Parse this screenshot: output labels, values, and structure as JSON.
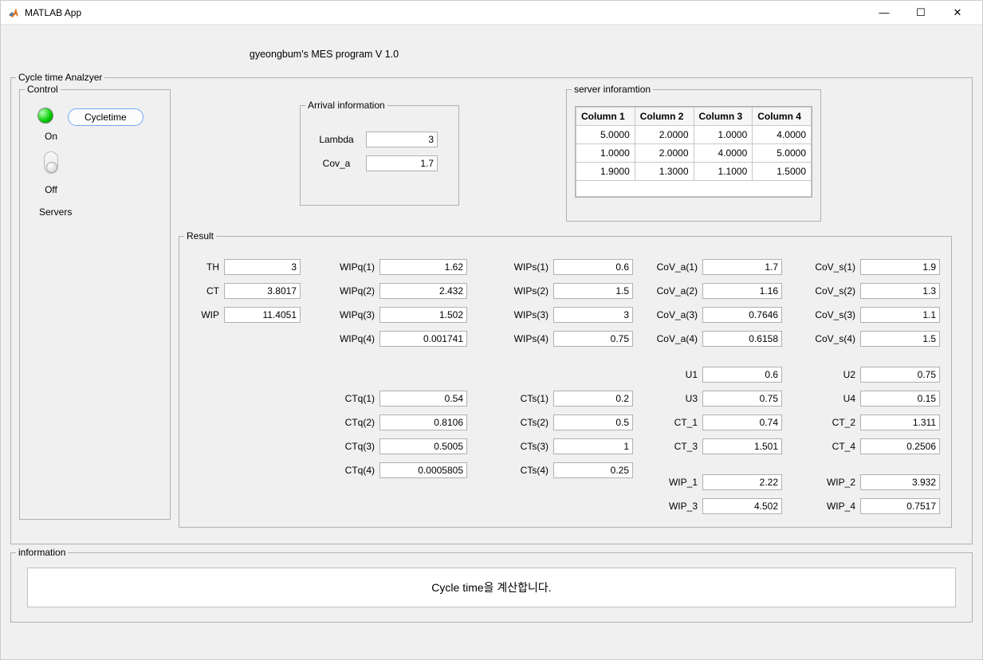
{
  "window": {
    "title": "MATLAB App"
  },
  "program_title": "gyeongbum's MES program V 1.0",
  "legends": {
    "analyzer": "Cycle time Analzyer",
    "control": "Control",
    "arrival": "Arrival information",
    "server": "server inforamtion",
    "result": "Result",
    "info": "information"
  },
  "control": {
    "on_label": "On",
    "off_label": "Off",
    "servers_label": "Servers",
    "cycle_btn": "Cycletime"
  },
  "arrival": {
    "lambda_label": "Lambda",
    "lambda_value": "3",
    "cova_label": "Cov_a",
    "cova_value": "1.7"
  },
  "server_table": {
    "headers": [
      "Column 1",
      "Column 2",
      "Column 3",
      "Column 4"
    ],
    "rows": [
      [
        "5.0000",
        "2.0000",
        "1.0000",
        "4.0000"
      ],
      [
        "1.0000",
        "2.0000",
        "4.0000",
        "5.0000"
      ],
      [
        "1.9000",
        "1.3000",
        "1.1000",
        "1.5000"
      ]
    ]
  },
  "result": {
    "TH": {
      "label": "TH",
      "value": "3"
    },
    "CT": {
      "label": "CT",
      "value": "3.8017"
    },
    "WIP": {
      "label": "WIP",
      "value": "11.4051"
    },
    "WIPq1": {
      "label": "WIPq(1)",
      "value": "1.62"
    },
    "WIPq2": {
      "label": "WIPq(2)",
      "value": "2.432"
    },
    "WIPq3": {
      "label": "WIPq(3)",
      "value": "1.502"
    },
    "WIPq4": {
      "label": "WIPq(4)",
      "value": "0.001741"
    },
    "WIPs1": {
      "label": "WIPs(1)",
      "value": "0.6"
    },
    "WIPs2": {
      "label": "WIPs(2)",
      "value": "1.5"
    },
    "WIPs3": {
      "label": "WIPs(3)",
      "value": "3"
    },
    "WIPs4": {
      "label": "WIPs(4)",
      "value": "0.75"
    },
    "CoVa1": {
      "label": "CoV_a(1)",
      "value": "1.7"
    },
    "CoVa2": {
      "label": "CoV_a(2)",
      "value": "1.16"
    },
    "CoVa3": {
      "label": "CoV_a(3)",
      "value": "0.7646"
    },
    "CoVa4": {
      "label": "CoV_a(4)",
      "value": "0.6158"
    },
    "CoVs1": {
      "label": "CoV_s(1)",
      "value": "1.9"
    },
    "CoVs2": {
      "label": "CoV_s(2)",
      "value": "1.3"
    },
    "CoVs3": {
      "label": "CoV_s(3)",
      "value": "1.1"
    },
    "CoVs4": {
      "label": "CoV_s(4)",
      "value": "1.5"
    },
    "U1": {
      "label": "U1",
      "value": "0.6"
    },
    "U2": {
      "label": "U2",
      "value": "0.75"
    },
    "U3": {
      "label": "U3",
      "value": "0.75"
    },
    "U4": {
      "label": "U4",
      "value": "0.15"
    },
    "CTq1": {
      "label": "CTq(1)",
      "value": "0.54"
    },
    "CTq2": {
      "label": "CTq(2)",
      "value": "0.8106"
    },
    "CTq3": {
      "label": "CTq(3)",
      "value": "0.5005"
    },
    "CTq4": {
      "label": "CTq(4)",
      "value": "0.0005805"
    },
    "CTs1": {
      "label": "CTs(1)",
      "value": "0.2"
    },
    "CTs2": {
      "label": "CTs(2)",
      "value": "0.5"
    },
    "CTs3": {
      "label": "CTs(3)",
      "value": "1"
    },
    "CTs4": {
      "label": "CTs(4)",
      "value": "0.25"
    },
    "CT1": {
      "label": "CT_1",
      "value": "0.74"
    },
    "CT2": {
      "label": "CT_2",
      "value": "1.311"
    },
    "CT3": {
      "label": "CT_3",
      "value": "1.501"
    },
    "CT4": {
      "label": "CT_4",
      "value": "0.2506"
    },
    "WIP1": {
      "label": "WIP_1",
      "value": "2.22"
    },
    "WIP2": {
      "label": "WIP_2",
      "value": "3.932"
    },
    "WIP3": {
      "label": "WIP_3",
      "value": "4.502"
    },
    "WIP4": {
      "label": "WIP_4",
      "value": "0.7517"
    }
  },
  "info_text": "Cycle time을 계산합니다."
}
